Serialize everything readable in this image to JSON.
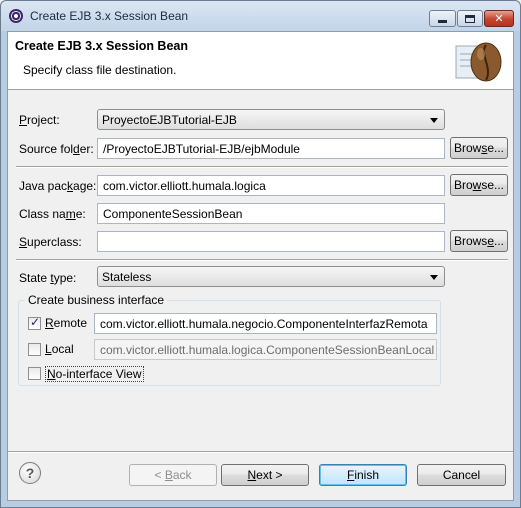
{
  "window": {
    "title": "Create EJB 3.x Session Bean"
  },
  "banner": {
    "title": "Create EJB 3.x Session Bean",
    "subtitle": "Specify class file destination."
  },
  "form": {
    "project": {
      "label_u": "P",
      "label_rest": "roject:",
      "value": "ProyectoEJBTutorial-EJB"
    },
    "source_folder": {
      "label_pre": "Source fol",
      "label_u": "d",
      "label_post": "er:",
      "value": "/ProyectoEJBTutorial-EJB/ejbModule",
      "browse": {
        "pre": "Brow",
        "u": "s",
        "post": "e..."
      }
    },
    "java_package": {
      "label_pre": "Java pac",
      "label_u": "k",
      "label_post": "age:",
      "value": "com.victor.elliott.humala.logica",
      "browse": {
        "pre": "Bro",
        "u": "w",
        "post": "se..."
      }
    },
    "class_name": {
      "label_pre": "Class na",
      "label_u": "m",
      "label_post": "e:",
      "value": "ComponenteSessionBean"
    },
    "superclass": {
      "label_u": "S",
      "label_rest": "uperclass:",
      "value": "",
      "browse": {
        "pre": "Brows",
        "u": "e",
        "post": "..."
      }
    },
    "state_type": {
      "label_pre": "State ",
      "label_u": "t",
      "label_post": "ype:",
      "value": "Stateless"
    }
  },
  "business_interface": {
    "title": "Create business interface",
    "remote": {
      "checked": true,
      "label_u": "R",
      "label_rest": "emote",
      "value": "com.victor.elliott.humala.negocio.ComponenteInterfazRemota"
    },
    "local": {
      "checked": false,
      "label_u": "L",
      "label_rest": "ocal",
      "value": "com.victor.elliott.humala.logica.ComponenteSessionBeanLocal"
    },
    "no_interface": {
      "checked": false,
      "label_u": "N",
      "label_rest": "o-interface View"
    }
  },
  "footer": {
    "help": "?",
    "back": {
      "pre": "< ",
      "u": "B",
      "post": "ack"
    },
    "next": {
      "pre": "",
      "u": "N",
      "post": "ext >"
    },
    "finish": {
      "pre": "",
      "u": "F",
      "post": "inish"
    },
    "cancel": "Cancel"
  },
  "icons": {
    "app": "eclipse-icon",
    "banner": "coffee-bean-icon",
    "help": "help-icon"
  }
}
